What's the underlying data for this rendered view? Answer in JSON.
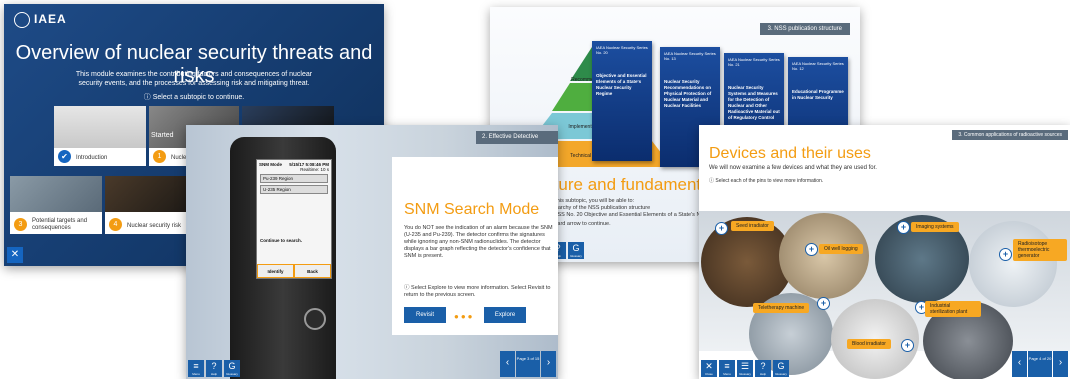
{
  "slide1": {
    "logo": "IAEA",
    "title": "Overview of nuclear security threats and risks",
    "intro": "This module examines the contributing factors and consequences of nuclear security events, and the processes for assessing risk and mitigating threat.",
    "hint": "Select a subtopic to continue.",
    "tiles": [
      {
        "label": "Introduction",
        "marker": "✔"
      },
      {
        "label": "Nuclea",
        "marker": "1"
      },
      {
        "label": "Potential targets and consequences",
        "marker": "3"
      },
      {
        "label": "Nuclear security risk",
        "marker": "4"
      }
    ],
    "started_label": "Started"
  },
  "slide2": {
    "tag": "3. NSS publication structure",
    "pyramid": [
      "Fundamentals",
      "Recommendations",
      "Implementing Guides",
      "Technical Guidance"
    ],
    "books": [
      {
        "series": "IAEA Nuclear Security Series No. 20",
        "title": "Objective and Essential Elements of a State's Nuclear Security Regime"
      },
      {
        "series": "IAEA Nuclear Security Series No. 13",
        "title": "Nuclear Security Recommendations on Physical Protection of Nuclear Material and Nuclear Facilities"
      },
      {
        "series": "IAEA Nuclear Security Series No. 21",
        "title": "Nuclear Security Systems and Measures for the Detection of Nuclear and Other Radioactive Material out of Regulatory Control"
      },
      {
        "series": "IAEA Nuclear Security Series No. 12",
        "title": "Educational Programme in Nuclear Security"
      }
    ],
    "heading": "Structure and fundamentals",
    "text": "After completing this subtopic, you will be able to:",
    "bullets": [
      "illustrate the hierarchy of the NSS publication structure",
      "recognise that NSS No. 20 Objective and Essential Elements of a State's Nuclear Security Regime underpins the Recommendations."
    ],
    "hint": "Select the forward arrow to continue.",
    "toolbar": [
      "Close",
      "Menu",
      "Glossary",
      "Help",
      "Glossary"
    ]
  },
  "slide3": {
    "tag": "2. Effective Detective",
    "screen": {
      "mode": "SNM Mode",
      "time": "5/15/17 5:08:46 PM",
      "real_time": "Realtime: 10 s",
      "row1": "Pu-239 Region",
      "row2": "U-235 Region",
      "msg": "Continue to search.",
      "btn_identify": "Identify",
      "btn_back": "Back"
    },
    "heading": "SNM Search Mode",
    "text": "You do NOT see the indication of an alarm because the SNM (U-235 and Pu-239). The detector confirms the signatures while ignoring any non-SNM radionuclides. The detector displays a bar graph reflecting the detector's confidence that SNM is present.",
    "hint": "Select Explore to view more information. Select Revisit to return to the previous screen.",
    "btn_revisit": "Revisit",
    "btn_explore": "Explore",
    "page": "Page 3 of 15",
    "toolbar": [
      "Menu",
      "Help",
      "Glossary"
    ]
  },
  "slide4": {
    "tag": "3. Common applications of radioactive sources",
    "heading": "Devices and their uses",
    "sub": "We will now examine a few devices and what they are used for.",
    "hint": "Select each of the pins to view more information.",
    "pins": [
      "Seed irradiator",
      "Oil well logging",
      "Imaging systems",
      "Radioisotope thermoelectric generator",
      "Teletherapy machine",
      "Industrial sterilization plant",
      "Blood irradiator"
    ],
    "page": "Page 4 of 20",
    "toolbar": [
      "Close",
      "Menu",
      "Glossary",
      "Help",
      "Glossary"
    ]
  }
}
